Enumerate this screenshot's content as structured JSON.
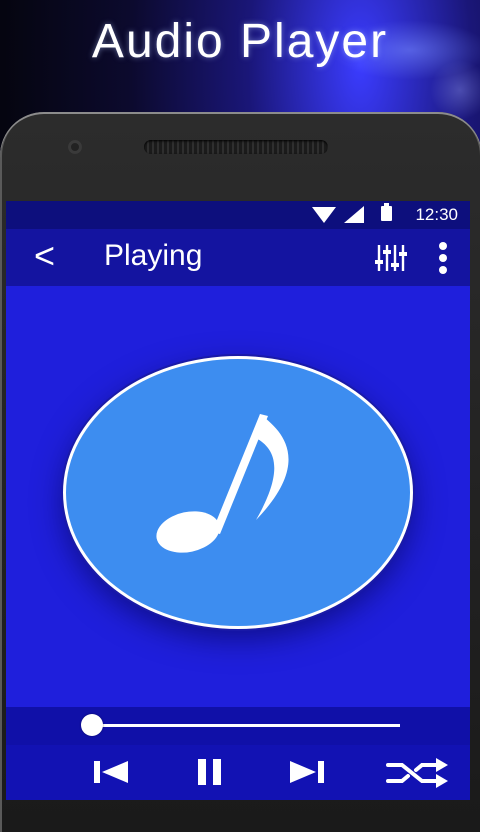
{
  "promo": {
    "title": "Audio Player"
  },
  "status_bar": {
    "time": "12:30",
    "icons": [
      "wifi-icon",
      "signal-icon",
      "battery-icon"
    ]
  },
  "toolbar": {
    "back_label": "<",
    "title": "Playing",
    "icons": [
      "equalizer-icon",
      "overflow-menu-icon"
    ]
  },
  "player": {
    "artwork_icon": "music-note-icon",
    "progress_fraction": 0.02,
    "controls": [
      "previous-icon",
      "pause-icon",
      "next-icon",
      "shuffle-icon"
    ]
  },
  "colors": {
    "status_bar": "#0d0f7d",
    "toolbar": "#1414a0",
    "artwork_background": "#1f1fdc",
    "disc": "#3d8df0",
    "controls_bar": "#1212b3"
  }
}
